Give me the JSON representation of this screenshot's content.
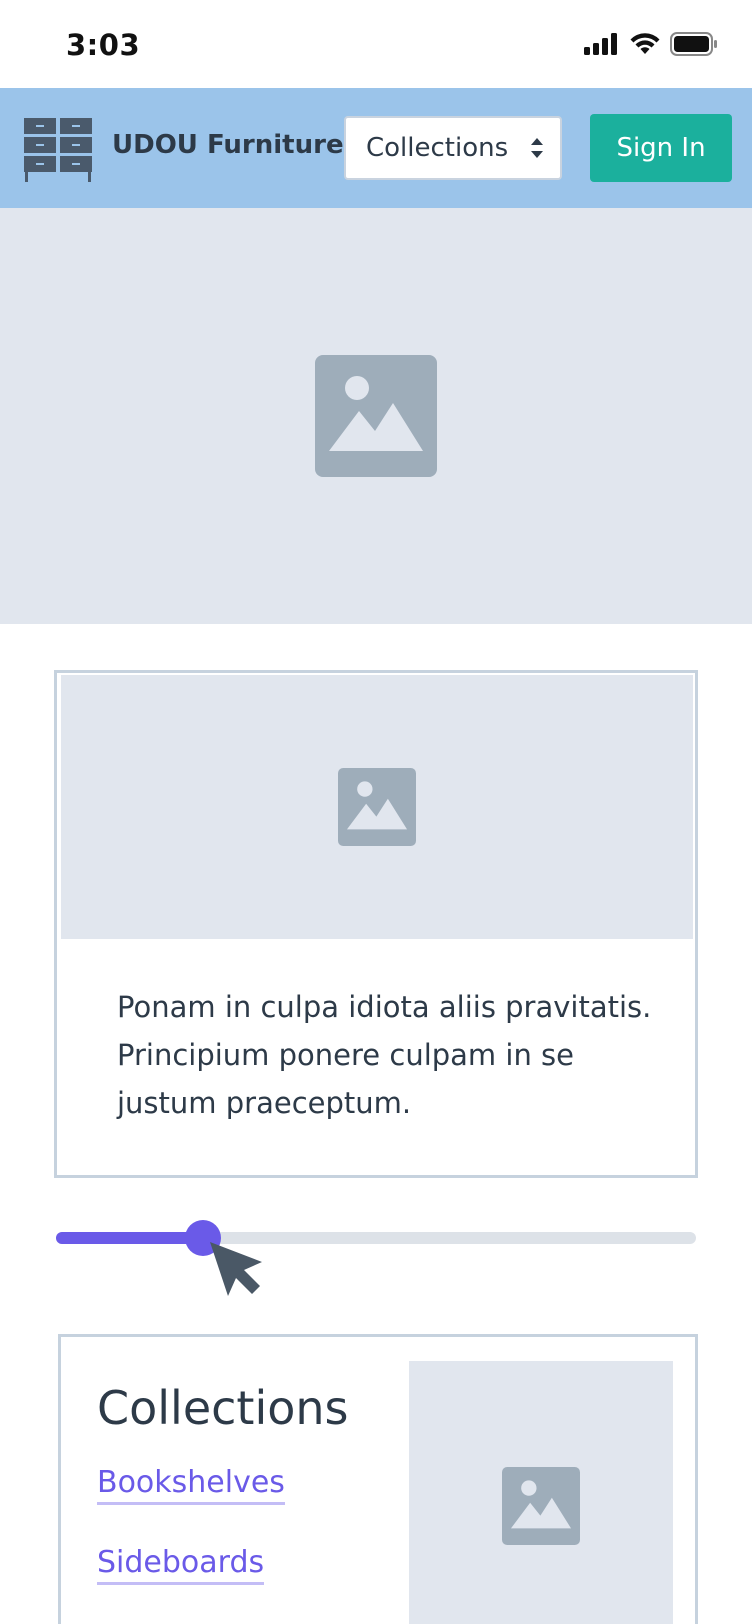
{
  "status": {
    "time": "3:03"
  },
  "header": {
    "brand": "UDOU Furniture",
    "select_value": "Collections",
    "signin_label": "Sign In"
  },
  "card": {
    "text": "Ponam in culpa idiota aliis pravitatis. Principium ponere culpam in se justum praeceptum."
  },
  "slider": {
    "value": 0.23
  },
  "collections": {
    "title": "Collections",
    "links": [
      "Bookshelves",
      "Sideboards"
    ]
  },
  "colors": {
    "header_bg": "#9bc4ea",
    "accent_green": "#1bb09d",
    "accent_purple": "#6a5ae8",
    "placeholder_bg": "#e1e6ee",
    "text_dark": "#2d3a48"
  },
  "icons": {
    "logo": "drawer-cabinet-icon",
    "image_placeholder": "image-icon",
    "select": "chevron-up-down-icon",
    "cursor": "mouse-pointer-icon"
  }
}
